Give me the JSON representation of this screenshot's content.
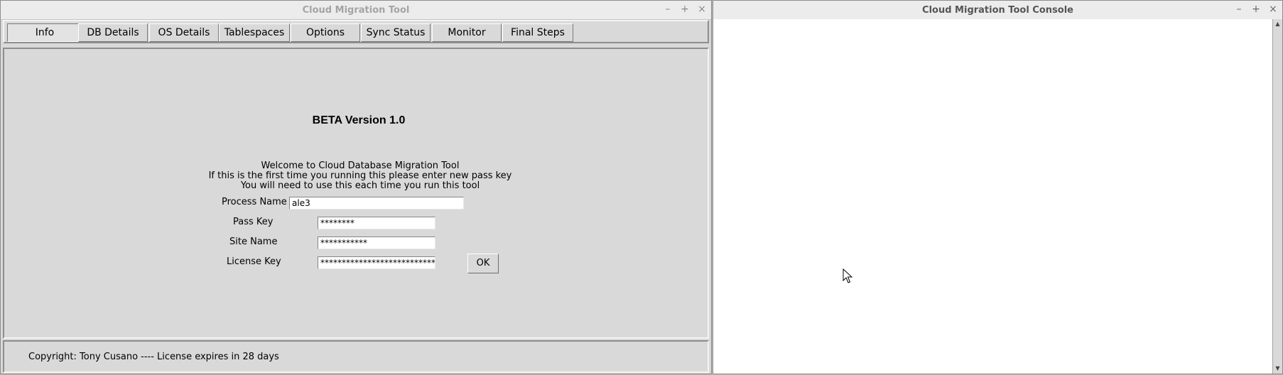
{
  "main_window": {
    "title": "Cloud Migration Tool",
    "controls": {
      "minimize": "–",
      "maximize": "+",
      "close": "×"
    },
    "tabs": [
      {
        "label": "Info",
        "active": true
      },
      {
        "label": "DB Details"
      },
      {
        "label": "OS Details"
      },
      {
        "label": "Tablespaces"
      },
      {
        "label": "Options"
      },
      {
        "label": "Sync Status"
      },
      {
        "label": "Monitor"
      },
      {
        "label": "Final Steps"
      }
    ],
    "heading": "BETA Version 1.0",
    "welcome_lines": [
      "Welcome to Cloud Database Migration Tool",
      "If this is the first time you running this please enter new pass key",
      "You will need to use this each time you run this tool"
    ],
    "form": {
      "process_name": {
        "label": "Process Name",
        "value": "ale3"
      },
      "pass_key": {
        "label": "Pass Key",
        "value": "********"
      },
      "site_name": {
        "label": "Site Name",
        "value": "***********"
      },
      "license_key": {
        "label": "License Key",
        "value": "****************************"
      },
      "ok_label": "OK"
    },
    "status": "Copyright: Tony Cusano ---- License expires in 28 days"
  },
  "console_window": {
    "title": "Cloud Migration Tool Console",
    "controls": {
      "minimize": "–",
      "maximize": "+",
      "close": "×"
    },
    "scroll_up": "▲",
    "scroll_down": "▼"
  }
}
